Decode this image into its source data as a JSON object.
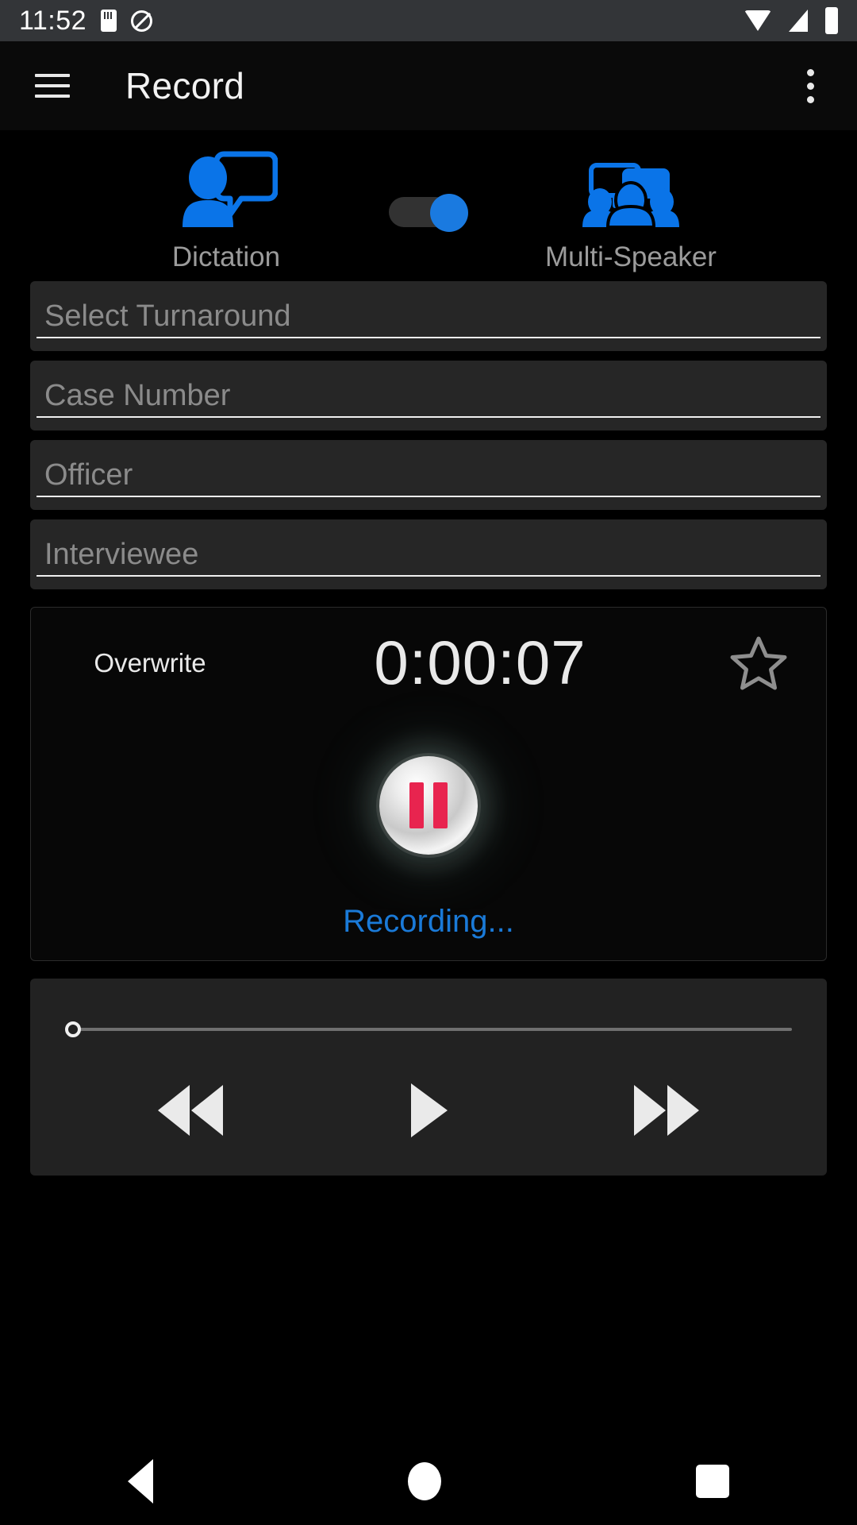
{
  "status_bar": {
    "time": "11:52",
    "icons": [
      "sd-card-icon",
      "mute-icon",
      "wifi-icon",
      "signal-icon",
      "battery-icon"
    ]
  },
  "app_bar": {
    "menu_icon": "hamburger-menu-icon",
    "title": "Record",
    "overflow_icon": "more-vertical-icon"
  },
  "mode_switch": {
    "left_label": "Dictation",
    "left_icon": "single-speaker-icon",
    "right_label": "Multi-Speaker",
    "right_icon": "multi-speaker-icon",
    "toggle_state": "right",
    "accent_color": "#1a7ae0",
    "track_color": "#323232"
  },
  "form": {
    "fields": [
      {
        "name": "turnaround",
        "placeholder": "Select Turnaround",
        "value": ""
      },
      {
        "name": "case-number",
        "placeholder": "Case Number",
        "value": ""
      },
      {
        "name": "officer",
        "placeholder": "Officer",
        "value": ""
      },
      {
        "name": "interviewee",
        "placeholder": "Interviewee",
        "value": ""
      }
    ]
  },
  "recorder": {
    "overwrite_label": "Overwrite",
    "timer": "0:00:07",
    "favorite_icon": "star-outline-icon",
    "record_button_icon": "pause-icon",
    "record_button_color": "#e8244f",
    "status_text": "Recording...",
    "status_color": "#1a7ad8"
  },
  "playback": {
    "seek_value": 0,
    "seek_min": 0,
    "seek_max": 100,
    "rewind_icon": "rewind-icon",
    "play_icon": "play-icon",
    "forward_icon": "fast-forward-icon"
  },
  "nav_bar": {
    "back_icon": "nav-back-icon",
    "home_icon": "nav-home-icon",
    "recents_icon": "nav-recents-icon"
  }
}
